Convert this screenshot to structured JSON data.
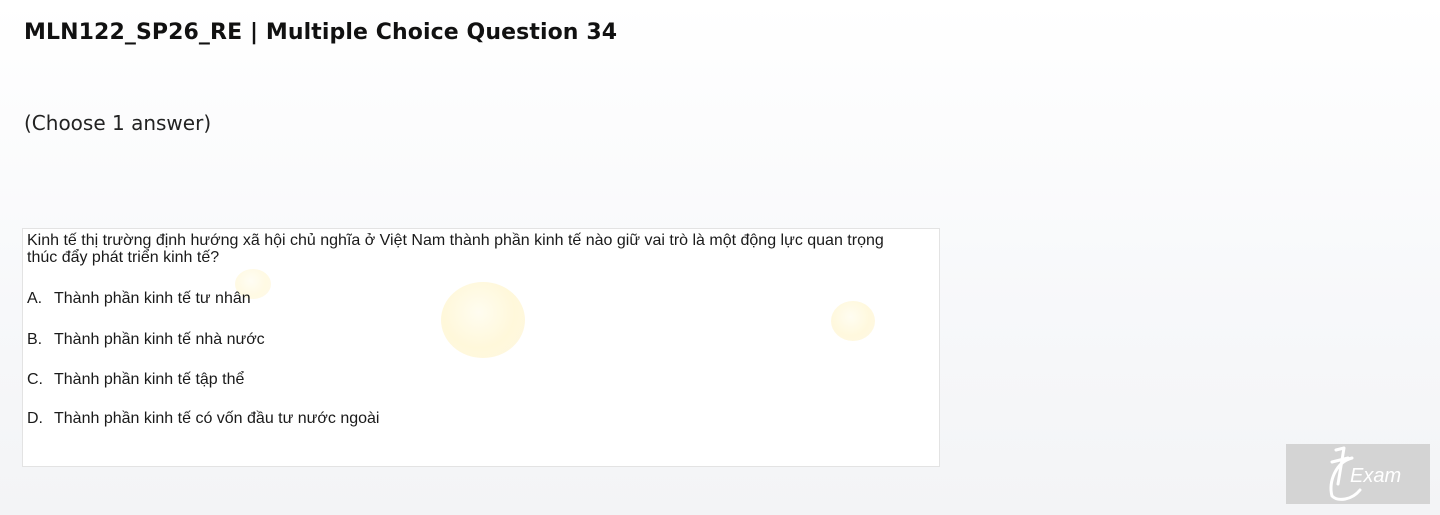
{
  "header": {
    "title": "MLN122_SP26_RE | Multiple Choice Question 34"
  },
  "instruction": "(Choose 1 answer)",
  "question": {
    "text": "Kinh tế thị trường định hướng xã hội chủ nghĩa ở Việt Nam thành phần kinh tế nào giữ vai trò là một động lực quan trọng thúc đẩy phát triển kinh tế?",
    "options": [
      {
        "letter": "A.",
        "text": "Thành phần kinh tế tư nhân"
      },
      {
        "letter": "B.",
        "text": "Thành phần kinh tế nhà nước"
      },
      {
        "letter": "C.",
        "text": "Thành phần kinh tế tập thể"
      },
      {
        "letter": "D.",
        "text": "Thành phần kinh tế có vốn đầu tư nước ngoài"
      }
    ]
  },
  "watermark": {
    "logo_text": "Exam",
    "logo_color": "#ffffff",
    "logo_bg": "#d4d4d4"
  }
}
